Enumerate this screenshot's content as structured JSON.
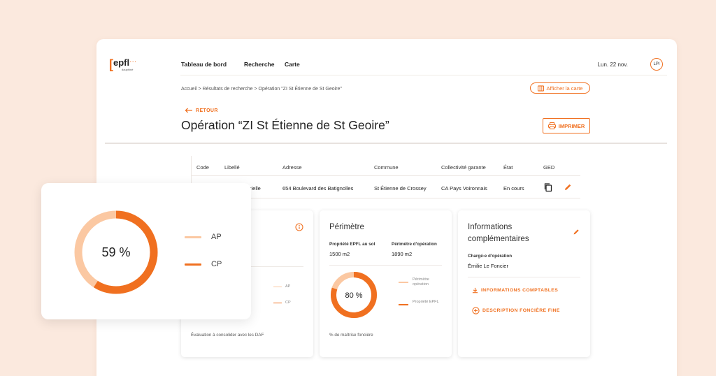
{
  "app": {
    "logo_text": "epfl",
    "logo_sub": "dauphiné",
    "nav": [
      "Tableau de bord",
      "Recherche",
      "Carte"
    ],
    "date": "Lun. 22 nov.",
    "user_initials": "LPI"
  },
  "breadcrumb": "Accueil > Résultats de recherche > Opération \"ZI St Étienne de St Geoire\"",
  "map_button": "Afficher la carte",
  "back_label": "RETOUR",
  "page_title": "Opération “ZI St Étienne de St Geoire”",
  "print_button": "IMPRIMER",
  "table": {
    "headers": [
      "Code",
      "Libellé",
      "Adresse",
      "Commune",
      "Collectivité garante",
      "État",
      "GED"
    ],
    "row": {
      "libelle_partial": "ustrielle",
      "adresse": "654 Boulevard des Batignolles",
      "commune": "St Étienne de Crossey",
      "collectivite": "CA Pays Voironnais",
      "etat": "En cours"
    }
  },
  "card_budget": {
    "legend": [
      "AP",
      "CP"
    ],
    "footer": "Évaluation à consolider avec les DAF"
  },
  "card_perimetre": {
    "title": "Périmètre",
    "label1": "Propriété EPFL au sol",
    "value1": "1500 m2",
    "label2": "Périmètre d'opération",
    "value2": "1890 m2",
    "donut_label": "80 %",
    "donut_fraction": 0.8,
    "legend": [
      "Périmètre opération",
      "Propriété EPFL"
    ],
    "footer": "% de maîtrise foncière"
  },
  "card_infos": {
    "title": "Informations complémentaires",
    "label": "Chargé-e d'opération",
    "value": "Émilie Le Foncier",
    "action1": "INFORMATIONS COMPTABLES",
    "action2": "DESCRIPTION FONCIÈRE FINE"
  },
  "float_card": {
    "donut_label": "59 %",
    "donut_fraction": 0.59,
    "legend": [
      "AP",
      "CP"
    ]
  },
  "colors": {
    "accent": "#f07020",
    "light": "#fbc8a2",
    "background": "#fbe9de"
  }
}
